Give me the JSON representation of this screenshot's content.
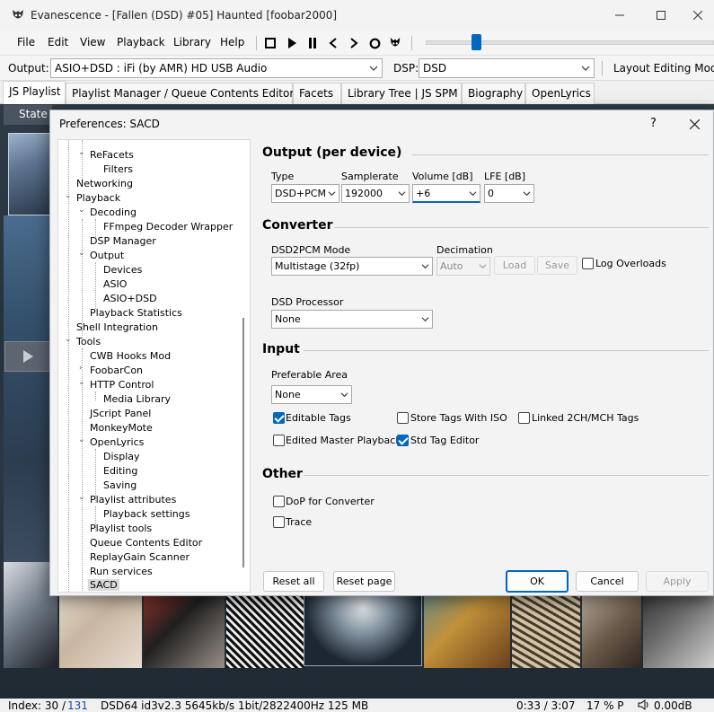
{
  "window": {
    "title": "Evanescence - [Fallen (DSD) #05] Haunted  [foobar2000]"
  },
  "menu": [
    "File",
    "Edit",
    "View",
    "Playback",
    "Library",
    "Help"
  ],
  "output_bar": {
    "output_label": "Output:",
    "output_value": "ASIO+DSD : iFi (by AMR) HD USB Audio",
    "dsp_label": "DSP:",
    "dsp_value": "DSD",
    "layout_label": "Layout Editing Mode"
  },
  "tabs": [
    "JS Playlist",
    "Playlist Manager / Queue Contents Editor",
    "Facets",
    "Library Tree | JS SPM",
    "Biography",
    "OpenLyrics"
  ],
  "player": {
    "state_label": "State"
  },
  "status": {
    "index_label": "Index: 30 /",
    "index_total": "131",
    "format": "DSD64 id3v2.3 5645kb/s 1bit/2822400Hz 125 MB",
    "time": "0:33 / 3:07",
    "percent": "17 % P",
    "volume": "0.00dB"
  },
  "dialog": {
    "title": "Preferences: SACD",
    "help": "?",
    "tree": [
      "ReFacets",
      "Filters",
      "Networking",
      "Playback",
      "Decoding",
      "FFmpeg Decoder Wrapper",
      "DSP Manager",
      "Output",
      "Devices",
      "ASIO",
      "ASIO+DSD",
      "Playback Statistics",
      "Shell Integration",
      "Tools",
      "CWB Hooks Mod",
      "FoobarCon",
      "HTTP Control",
      "Media Library",
      "JScript Panel",
      "MonkeyMote",
      "OpenLyrics",
      "Display",
      "Editing",
      "Saving",
      "Playlist attributes",
      "Playback settings",
      "Playlist tools",
      "Queue Contents Editor",
      "ReplayGain Scanner",
      "Run services",
      "SACD"
    ],
    "output_section": {
      "title": "Output (per device)",
      "type_label": "Type",
      "type_value": "DSD+PCM",
      "samplerate_label": "Samplerate",
      "samplerate_value": "192000",
      "volume_label": "Volume [dB]",
      "volume_value": "+6",
      "lfe_label": "LFE [dB]",
      "lfe_value": "0"
    },
    "converter_section": {
      "title": "Converter",
      "mode_label": "DSD2PCM Mode",
      "mode_value": "Multistage (32fp)",
      "decimation_label": "Decimation",
      "decimation_value": "Auto",
      "load_label": "Load",
      "save_label": "Save",
      "log_overloads_label": "Log Overloads",
      "processor_label": "DSD Processor",
      "processor_value": "None"
    },
    "input_section": {
      "title": "Input",
      "area_label": "Preferable Area",
      "area_value": "None",
      "editable_tags": "Editable Tags",
      "store_tags_iso": "Store Tags With ISO",
      "linked_tags": "Linked 2CH/MCH Tags",
      "edited_master": "Edited Master Playback",
      "std_tag_editor": "Std Tag Editor"
    },
    "other_section": {
      "title": "Other",
      "dop_label": "DoP for Converter",
      "trace_label": "Trace"
    },
    "buttons": {
      "reset_all": "Reset all",
      "reset_page": "Reset page",
      "ok": "OK",
      "cancel": "Cancel",
      "apply": "Apply"
    }
  }
}
